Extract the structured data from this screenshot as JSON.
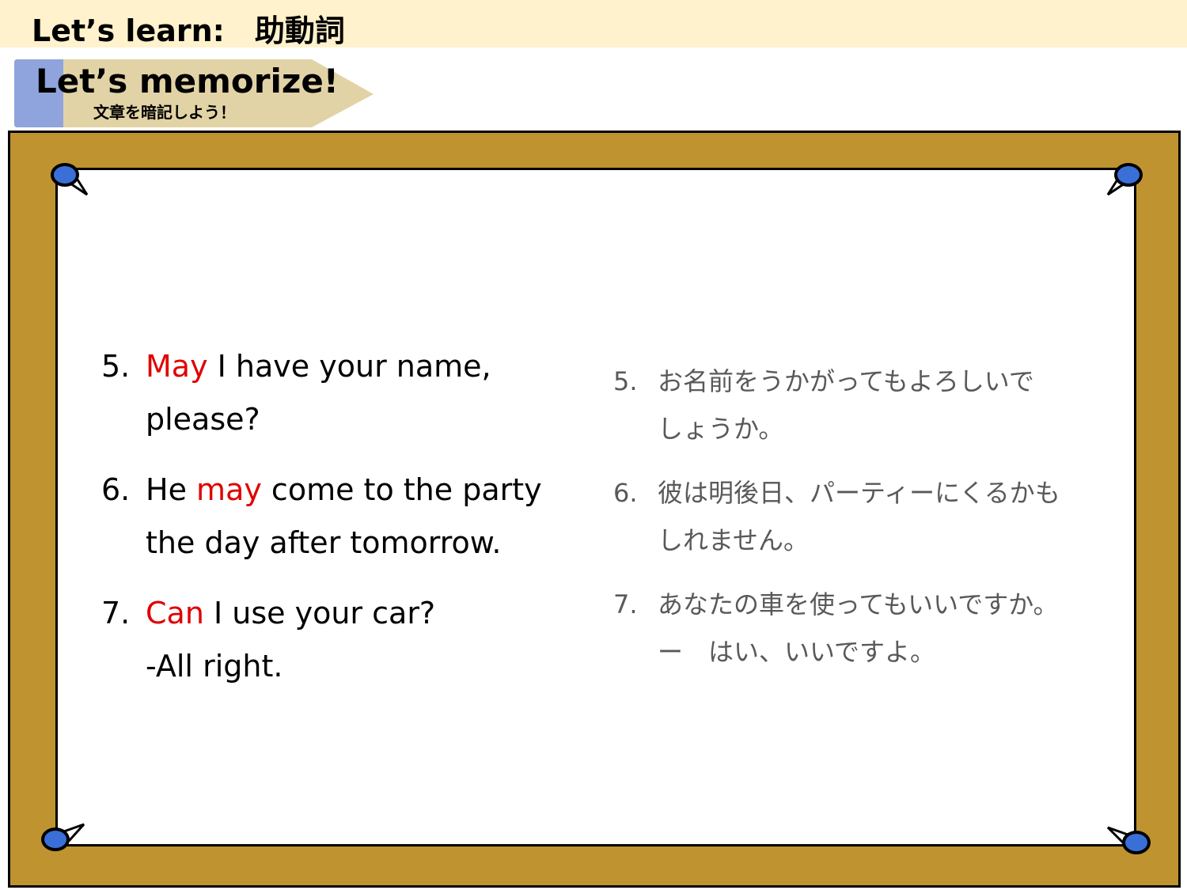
{
  "header": {
    "title": "Let’s learn:　助動詞"
  },
  "banner": {
    "title": "Let’s memorize!",
    "subtitle": "文章を暗記しよう！"
  },
  "colors": {
    "header_bg": "#fff2cc",
    "board_wood": "#bf9330",
    "highlight": "#e00000",
    "pin": "#3a6fd8",
    "pencil_body": "#e2d3a6",
    "pencil_band": "#8fa4dc"
  },
  "english": [
    {
      "number": "5.",
      "modal": "May",
      "rest_line1": " I have your name,",
      "line2": "please?"
    },
    {
      "number": "6.",
      "before": "He ",
      "modal": "may",
      "rest_line1": " come to the party",
      "line2": "the day after tomorrow."
    },
    {
      "number": "7.",
      "modal": "Can",
      "rest_line1": " I use your car?",
      "line2": "-All right."
    }
  ],
  "japanese": [
    {
      "number": "5.",
      "line1": "お名前をうかがってもよろしいで",
      "line2": "しょうか。"
    },
    {
      "number": "6.",
      "line1": "彼は明後日、パーティーにくるかも",
      "line2": "しれません。"
    },
    {
      "number": "7.",
      "line1": "あなたの車を使ってもいいですか。",
      "line2": "ー　はい、いいですよ。"
    }
  ]
}
